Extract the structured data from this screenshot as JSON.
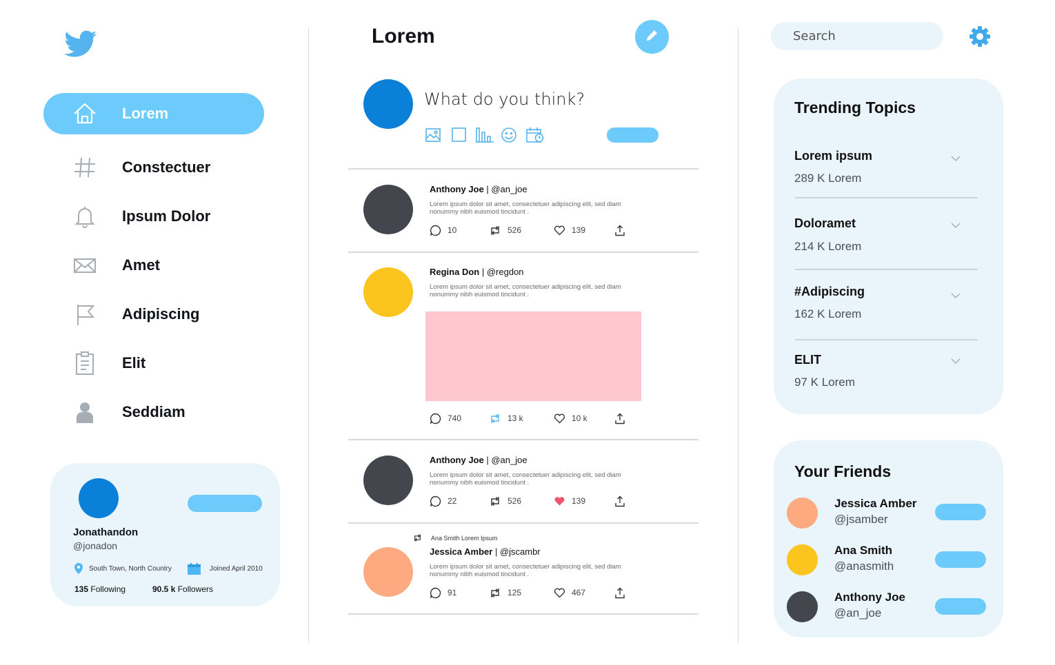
{
  "sidebar": {
    "items": [
      {
        "label": "Lorem",
        "icon": "home-icon"
      },
      {
        "label": "Constectuer",
        "icon": "hashtag-icon"
      },
      {
        "label": "Ipsum Dolor",
        "icon": "bell-icon"
      },
      {
        "label": "Amet",
        "icon": "mail-icon"
      },
      {
        "label": "Adipiscing",
        "icon": "flag-icon"
      },
      {
        "label": "Elit",
        "icon": "clipboard-icon"
      },
      {
        "label": "Seddiam",
        "icon": "person-icon"
      }
    ],
    "profile": {
      "name": "Jonathandon",
      "handle": "@jonadon",
      "location": "South Town, North Country",
      "joined": "Joined April 2010",
      "following_count": "135",
      "following_label": " Following",
      "followers_count": "90.5 k",
      "followers_label": " Followers"
    }
  },
  "feed": {
    "title": "Lorem",
    "compose_placeholder": "What do you think?",
    "tweets": [
      {
        "name": "Anthony Joe",
        "handle": "| @an_joe",
        "text": "Lorem ipsum dolor sit amet, consectetuer adipiscing elit, sed diam nonummy nibh euismod tincidunt .",
        "replies": "10",
        "retweets": "526",
        "likes": "139",
        "avatar_color": "#43474d"
      },
      {
        "name": "Regina Don",
        "handle": "| @regdon",
        "text": "Lorem ipsum dolor sit amet, consectetuer adipiscing elit, sed diam nonummy nibh euismod tincidunt .",
        "replies": "740",
        "retweets": "13 k",
        "likes": "10 k",
        "avatar_color": "#fcc41e",
        "retweeted": true
      },
      {
        "name": "Anthony Joe",
        "handle": "| @an_joe",
        "text": "Lorem ipsum dolor sit amet, consectetuer adipiscing elit, sed diam nonummy nibh euismod tincidunt .",
        "replies": "22",
        "retweets": "526",
        "likes": "139",
        "avatar_color": "#43474d",
        "liked": true
      },
      {
        "retweet_note": "Ana Smith Lorem Ipsum",
        "name": "Jessica Amber",
        "handle": "| @jscambr",
        "text": "Lorem ipsum dolor sit amet, consectetuer adipiscing elit, sed diam nonummy nibh euismod tincidunt .",
        "replies": "91",
        "retweets": "125",
        "likes": "467",
        "avatar_color": "#fdaa80"
      }
    ]
  },
  "right": {
    "search_placeholder": "Search",
    "trending_title": "Trending Topics",
    "trends": [
      {
        "name": "Lorem ipsum",
        "count": "289 K Lorem"
      },
      {
        "name": "Doloramet",
        "count": "214 K Lorem"
      },
      {
        "name": "#Adipiscing",
        "count": "162 K Lorem"
      },
      {
        "name": "ELIT",
        "count": "97 K Lorem"
      }
    ],
    "friends_title": "Your Friends",
    "friends": [
      {
        "name": "Jessica Amber",
        "handle": "@jsamber",
        "avatar_color": "#fdaa80"
      },
      {
        "name": "Ana Smith",
        "handle": "@anasmith",
        "avatar_color": "#fcc41e"
      },
      {
        "name": "Anthony Joe",
        "handle": "@an_joe",
        "avatar_color": "#43474d"
      }
    ]
  },
  "colors": {
    "accent": "#6ccbfb",
    "brand_blue": "#0a80d8",
    "panel_bg": "#eaf4fb",
    "like_red": "#f0566f",
    "icon_gray": "#a6adb4"
  }
}
